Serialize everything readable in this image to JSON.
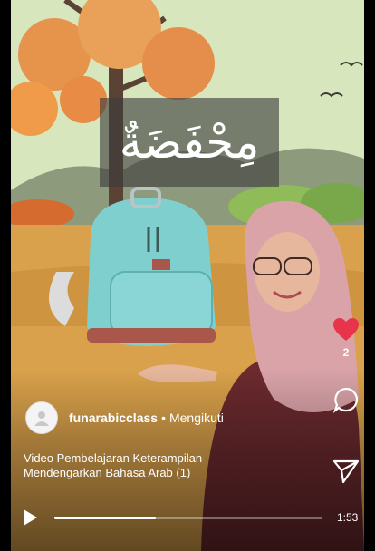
{
  "lesson": {
    "arabic_word": "مِحْفَضَةٌ"
  },
  "post": {
    "username": "funarabicclass",
    "separator": "•",
    "follow_status": "Mengikuti",
    "caption": "Video Pembelajaran Keterampilan Mendengarkan Bahasa Arab (1)"
  },
  "actions": {
    "like_count": "2",
    "like_icon": "heart-icon",
    "comment_icon": "comment-icon",
    "share_icon": "send-icon"
  },
  "player": {
    "time": "1:53",
    "progress_fraction": 0.38,
    "play_icon": "play-icon"
  },
  "colors": {
    "like_red": "#e8344b",
    "bag_teal": "#7fcfcf"
  }
}
